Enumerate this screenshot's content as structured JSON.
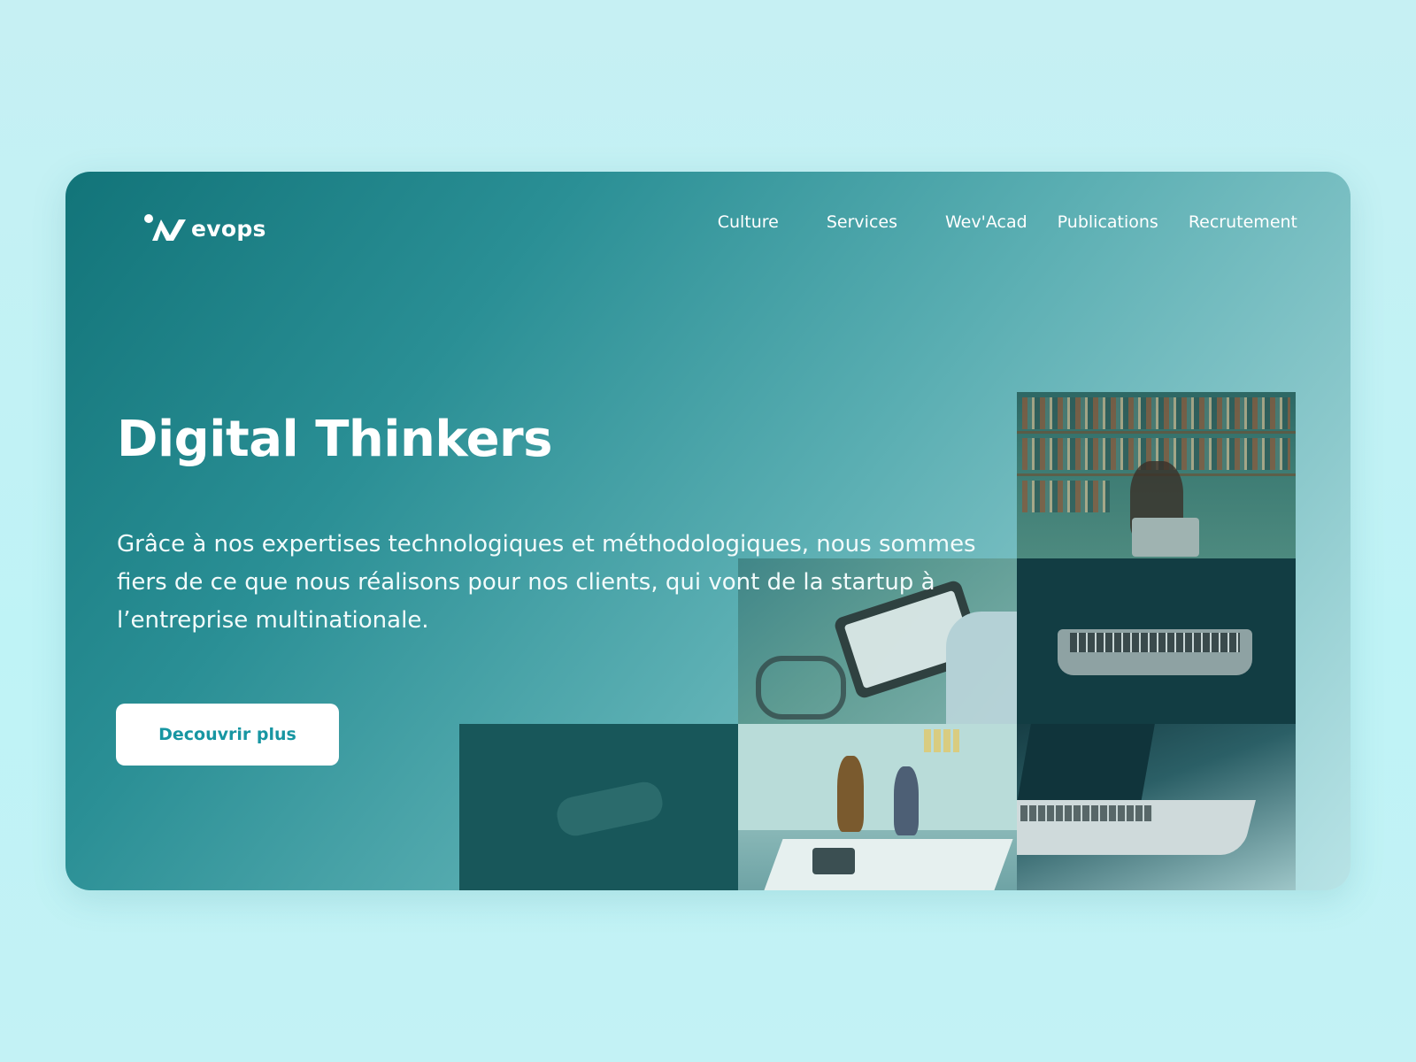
{
  "brand": {
    "name": "evops"
  },
  "nav": {
    "items": [
      {
        "label": "Culture"
      },
      {
        "label": "Services"
      },
      {
        "label": "Wev'Acad"
      },
      {
        "label": "Publications"
      },
      {
        "label": "Recrutement"
      }
    ]
  },
  "hero": {
    "title": "Digital Thinkers",
    "description": "Grâce à nos expertises technologiques et méthodologiques, nous sommes fiers de ce que nous réalisons pour nos clients, qui vont de la startup à l’entreprise multinationale.",
    "cta_label": "Decouvrir plus"
  },
  "colors": {
    "card_gradient_start": "#127479",
    "card_gradient_end": "#b8e3e6",
    "cta_text": "#1796a2",
    "page_background": "#c2f1f4"
  }
}
